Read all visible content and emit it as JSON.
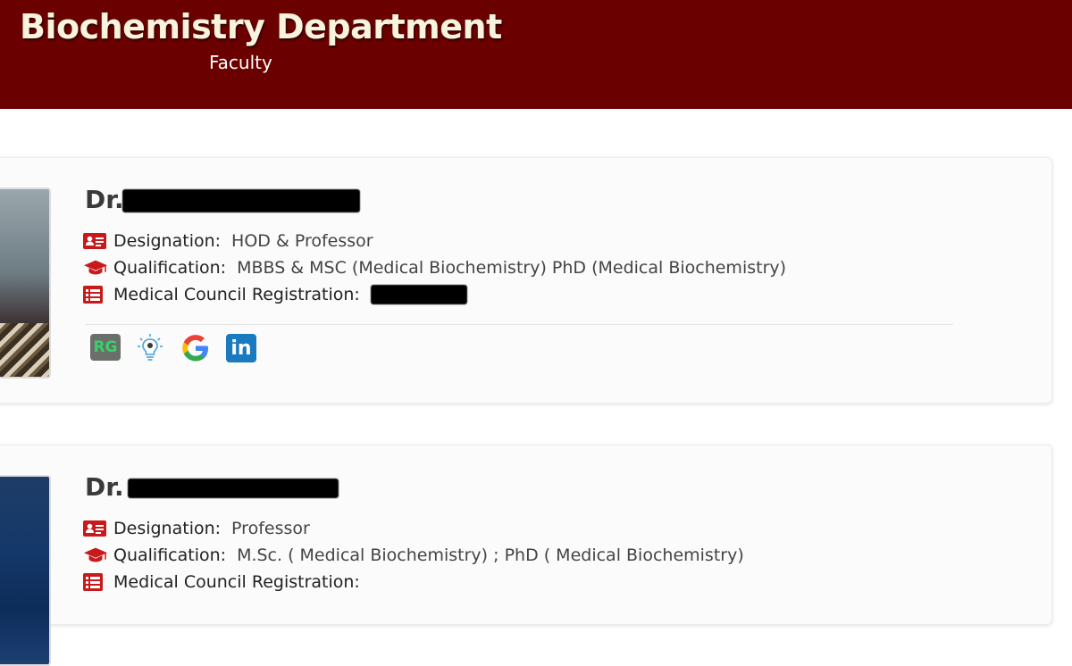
{
  "header": {
    "title": "Biochemistry Department",
    "subtitle": "Faculty"
  },
  "faculty": [
    {
      "name_prefix": "Dr.",
      "designation_label": "Designation:",
      "designation": "HOD & Professor",
      "qualification_label": "Qualification:",
      "qualification": "MBBS & MSC (Medical Biochemistry) PhD (Medical Biochemistry)",
      "registration_label": "Medical Council Registration:",
      "social_icons": [
        "researchgate-icon",
        "idea-bulb-icon",
        "google-icon",
        "linkedin-icon"
      ],
      "researchgate_text": "RG",
      "linkedin_text": "in"
    },
    {
      "name_prefix": "Dr.",
      "designation_label": "Designation:",
      "designation": "Professor",
      "qualification_label": "Qualification:",
      "qualification": "M.Sc. ( Medical Biochemistry) ; PhD ( Medical Biochemistry)",
      "registration_label": "Medical Council Registration:"
    }
  ],
  "colors": {
    "banner": "#6b0000",
    "icon_red": "#c8191b",
    "linkedin": "#1a7abf"
  }
}
